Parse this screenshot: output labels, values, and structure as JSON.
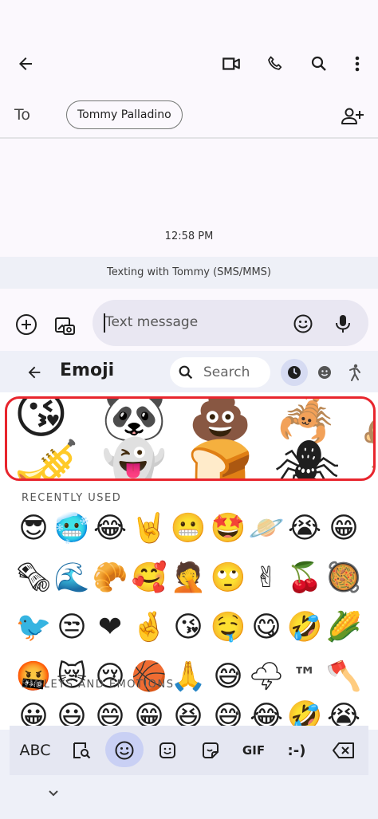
{
  "header": {
    "to_label": "To",
    "recipient_chip": "Tommy Palladino",
    "icons": [
      "back-arrow-icon",
      "video-call-icon",
      "phone-icon",
      "search-icon",
      "more-vert-icon",
      "add-person-icon"
    ]
  },
  "thread": {
    "timestamp": "12:58 PM",
    "banner": "Texting with Tommy (SMS/MMS)"
  },
  "compose": {
    "placeholder": "Text message"
  },
  "emoji_panel": {
    "title": "Emoji",
    "search_placeholder": "Search",
    "suggestions": [
      "😘🎺",
      "🐼👻",
      "💩🍞",
      "🦂🕷"
    ],
    "recent_label": "RECENTLY USED",
    "recent": [
      [
        "😎",
        "🥶",
        "😂",
        "🤘",
        "😬",
        "🤩",
        "🪐",
        "😭",
        "😁"
      ],
      [
        "🗞",
        "🌊",
        "🥐",
        "🥰",
        "🤦",
        "🙄",
        "✌",
        "🍒",
        "🥘"
      ],
      [
        "🐦",
        "😒",
        "❤",
        "🤞",
        "😘",
        "🤤",
        "😋",
        "🤣",
        "🌽"
      ],
      [
        "🤬",
        "😿",
        "😢",
        "🏀",
        "🙏",
        "😅",
        "🌩",
        "™",
        "🪓"
      ]
    ],
    "smileys_label": "SMILEYS AND EMOTIONS",
    "smileys": [
      "😀",
      "😃",
      "😄",
      "😁",
      "😆",
      "😅",
      "😂",
      "🤣",
      "😭"
    ]
  },
  "keyboard_bar": {
    "abc_label": "ABC",
    "gif_label": "GIF",
    "emoticon_label": ":-)"
  },
  "colors": {
    "highlight": "#e8252d",
    "accent": "#c9d0f4"
  }
}
